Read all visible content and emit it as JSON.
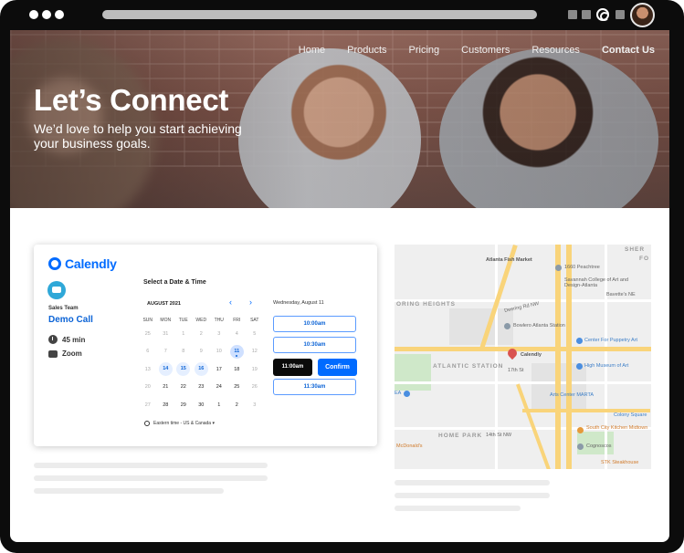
{
  "browser": {
    "toolbar_icons": [
      "square-icon",
      "square-icon",
      "calendly-logo-icon",
      "square-icon",
      "profile-avatar"
    ]
  },
  "nav": {
    "items": [
      {
        "label": "Home"
      },
      {
        "label": "Products"
      },
      {
        "label": "Pricing"
      },
      {
        "label": "Customers"
      },
      {
        "label": "Resources"
      },
      {
        "label": "Contact Us"
      }
    ]
  },
  "hero": {
    "title": "Let’s Connect",
    "subtitle": "We’d love to help you start achieving your business goals."
  },
  "calendly": {
    "brand": "Calendly",
    "brand_color": "#006bff",
    "team": "Sales Team",
    "event": "Demo Call",
    "duration": "45 min",
    "location": "Zoom",
    "heading": "Select a Date & Time",
    "month": "AUGUST 2021",
    "selected_date": "Wednesday, August 11",
    "weekdays": [
      "SUN",
      "MON",
      "TUE",
      "WED",
      "THU",
      "FRI",
      "SAT"
    ],
    "weeks": [
      [
        {
          "d": "25",
          "s": "muted"
        },
        {
          "d": "31",
          "s": "muted"
        },
        {
          "d": "1",
          "s": "muted"
        },
        {
          "d": "2",
          "s": "muted"
        },
        {
          "d": "3",
          "s": "muted"
        },
        {
          "d": "4",
          "s": "muted"
        },
        {
          "d": "5",
          "s": "muted"
        }
      ],
      [
        {
          "d": "6",
          "s": "muted"
        },
        {
          "d": "7",
          "s": "muted"
        },
        {
          "d": "8",
          "s": "muted"
        },
        {
          "d": "9",
          "s": "muted"
        },
        {
          "d": "10",
          "s": "muted"
        },
        {
          "d": "11",
          "s": "sel"
        },
        {
          "d": "12",
          "s": "muted"
        }
      ],
      [
        {
          "d": "13",
          "s": "muted"
        },
        {
          "d": "14",
          "s": "avail"
        },
        {
          "d": "15",
          "s": "avail"
        },
        {
          "d": "16",
          "s": "avail"
        },
        {
          "d": "17",
          "s": ""
        },
        {
          "d": "18",
          "s": ""
        },
        {
          "d": "19",
          "s": "muted"
        }
      ],
      [
        {
          "d": "20",
          "s": "muted"
        },
        {
          "d": "21",
          "s": ""
        },
        {
          "d": "22",
          "s": ""
        },
        {
          "d": "23",
          "s": ""
        },
        {
          "d": "24",
          "s": ""
        },
        {
          "d": "25",
          "s": ""
        },
        {
          "d": "26",
          "s": "muted"
        }
      ],
      [
        {
          "d": "27",
          "s": "muted"
        },
        {
          "d": "28",
          "s": ""
        },
        {
          "d": "29",
          "s": ""
        },
        {
          "d": "30",
          "s": ""
        },
        {
          "d": "1",
          "s": ""
        },
        {
          "d": "2",
          "s": ""
        },
        {
          "d": "3",
          "s": "muted"
        }
      ]
    ],
    "slots": [
      "10:00am",
      "10:30am",
      "11:30am"
    ],
    "selected_slot": "11:00am",
    "confirm_label": "Confirm",
    "timezone": "Eastern time - US & Canada ▾"
  },
  "map": {
    "labels": {
      "sher": "SHER",
      "fo": "FO",
      "atlanta_fish": "Atlanta Fish Market",
      "peachtree_1660": "1660 Peachtree",
      "savannah": "Savannah College of Art and Design-Atlanta",
      "deering": "Deering Rd NW",
      "bowlero": "Bowlero Atlanta Station",
      "spring_heights": "ORING HEIGHTS",
      "bavette": "Bavette's NE",
      "calendly": "Calendly",
      "puppetry": "Center For Puppetry Art",
      "atlantic_station": "ATLANTIC STATION",
      "st17": "17th St",
      "high_museum": "High Museum of Art",
      "arts_center": "Arts Center MARTA",
      "ea": "EA",
      "colony": "Colony Square",
      "home_park": "HOME PARK",
      "st14": "14th St NW",
      "south_city": "South City Kitchen Midtown",
      "mcdonald": "McDonald's",
      "cognoscos": "Cognoscos",
      "stk": "STK Steakhouse"
    }
  }
}
